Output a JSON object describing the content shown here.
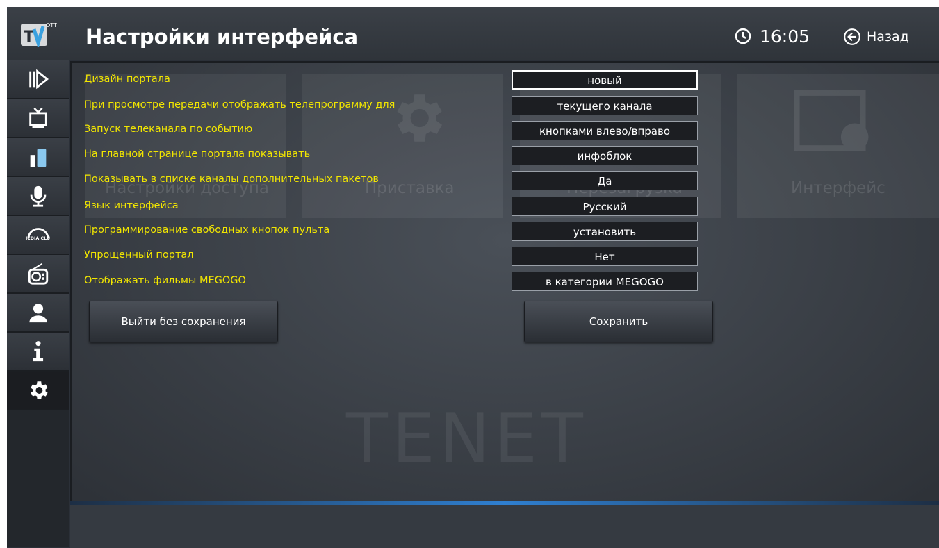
{
  "header": {
    "logo_text": "TV",
    "logo_sup": "OTT",
    "title": "Настройки интерфейса",
    "time": "16:05",
    "back_label": "Назад"
  },
  "sidebar": {
    "items": [
      {
        "name": "play-icon"
      },
      {
        "name": "tv-icon"
      },
      {
        "name": "phone-icon"
      },
      {
        "name": "microphone-icon"
      },
      {
        "name": "media-club-icon",
        "text": "MEDIA CLUB"
      },
      {
        "name": "radio-icon"
      },
      {
        "name": "user-icon"
      },
      {
        "name": "info-icon"
      },
      {
        "name": "gear-icon",
        "active": true
      }
    ]
  },
  "background": {
    "tiles": [
      "Настройки доступа",
      "Приставка",
      "Перезагрузка",
      "Интерфейс"
    ],
    "watermark": "TENET"
  },
  "settings": [
    {
      "label": "Дизайн портала",
      "value": "новый",
      "selected": true
    },
    {
      "label": "При просмотре передачи отображать телепрограмму для",
      "value": "текущего канала"
    },
    {
      "label": "Запуск телеканала по событию",
      "value": "кнопками влево/вправо"
    },
    {
      "label": "На главной странице портала показывать",
      "value": "инфоблок"
    },
    {
      "label": "Показывать в списке каналы дополнительных пакетов",
      "value": "Да"
    },
    {
      "label": "Язык интерфейса",
      "value": "Русский"
    },
    {
      "label": "Программирование свободных кнопок пульта",
      "value": "установить"
    },
    {
      "label": "Упрощенный портал",
      "value": "Нет"
    },
    {
      "label": "Отображать фильмы MEGOGO",
      "value": "в категории MEGOGO"
    }
  ],
  "actions": {
    "exit_label": "Выйти без сохранения",
    "save_label": "Сохранить"
  },
  "colors": {
    "label": "#f2e600",
    "accent_line": "#2f7fd0"
  }
}
